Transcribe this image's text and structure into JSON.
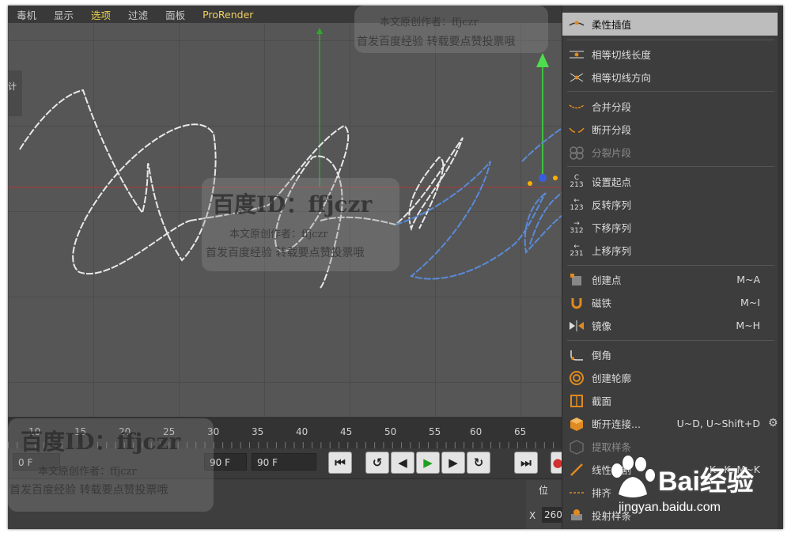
{
  "menubar": {
    "items": [
      "毒机",
      "显示",
      "选项",
      "过滤",
      "面板",
      "ProRender"
    ]
  },
  "side_tab": "计",
  "timeline": {
    "ticks": [
      "10",
      "15",
      "20",
      "25",
      "30",
      "35",
      "40",
      "45",
      "50",
      "55",
      "60",
      "65"
    ]
  },
  "transport": {
    "start_frame": "0 F",
    "end_frame_a": "90 F",
    "end_frame_b": "90 F"
  },
  "coords": {
    "label": "位",
    "x_label": "X",
    "x_value": "260"
  },
  "context_menu": {
    "items": [
      {
        "label": "柔性插值",
        "shortcut": "",
        "icon": "soft-interpolation-icon",
        "highlighted": true
      },
      {
        "label": "相等切线长度",
        "shortcut": "",
        "icon": "equal-tangent-length-icon"
      },
      {
        "label": "相等切线方向",
        "shortcut": "",
        "icon": "equal-tangent-direction-icon"
      },
      {
        "label": "合并分段",
        "shortcut": "",
        "icon": "join-segment-icon"
      },
      {
        "label": "断开分段",
        "shortcut": "",
        "icon": "break-segment-icon"
      },
      {
        "label": "分裂片段",
        "shortcut": "",
        "icon": "explode-segments-icon",
        "disabled": true
      },
      {
        "label": "设置起点",
        "shortcut": "",
        "icon": "set-first-point-icon"
      },
      {
        "label": "反转序列",
        "shortcut": "",
        "icon": "reverse-sequence-icon"
      },
      {
        "label": "下移序列",
        "shortcut": "",
        "icon": "move-down-sequence-icon"
      },
      {
        "label": "上移序列",
        "shortcut": "",
        "icon": "move-up-sequence-icon"
      },
      {
        "label": "创建点",
        "shortcut": "M~A",
        "icon": "create-point-icon"
      },
      {
        "label": "磁铁",
        "shortcut": "M~I",
        "icon": "magnet-icon"
      },
      {
        "label": "镜像",
        "shortcut": "M~H",
        "icon": "mirror-icon"
      },
      {
        "label": "倒角",
        "shortcut": "",
        "icon": "chamfer-icon"
      },
      {
        "label": "创建轮廓",
        "shortcut": "",
        "icon": "create-outline-icon"
      },
      {
        "label": "截面",
        "shortcut": "",
        "icon": "cross-section-icon"
      },
      {
        "label": "断开连接...",
        "shortcut": "U~D, U~Shift+D",
        "icon": "disconnect-icon"
      },
      {
        "label": "提取样条",
        "shortcut": "",
        "icon": "extract-spline-icon",
        "disabled": true
      },
      {
        "label": "线性切割",
        "shortcut": "K~K, M~K",
        "icon": "line-cut-icon"
      },
      {
        "label": "排齐",
        "shortcut": "",
        "icon": "align-icon"
      },
      {
        "label": "投射样条",
        "shortcut": "",
        "icon": "project-spline-icon"
      }
    ]
  },
  "watermarks": {
    "center_id": "百度ID：ffjczr",
    "center_author": "本文原创作者：ffjczr",
    "center_note": "首发百度经验  转载要点赞投票哦",
    "top_author": "本文原创作者：ffjczr",
    "top_note": "首发百度经验  转载要点赞投票哦",
    "bottom_id": "百度ID：ffjczr",
    "bottom_author": "本文原创作者：ffjczr",
    "bottom_note": "首发百度经验  转载要点赞投票哦",
    "logo_text": "Bai经验",
    "logo_url": "jingyan.baidu.com"
  }
}
